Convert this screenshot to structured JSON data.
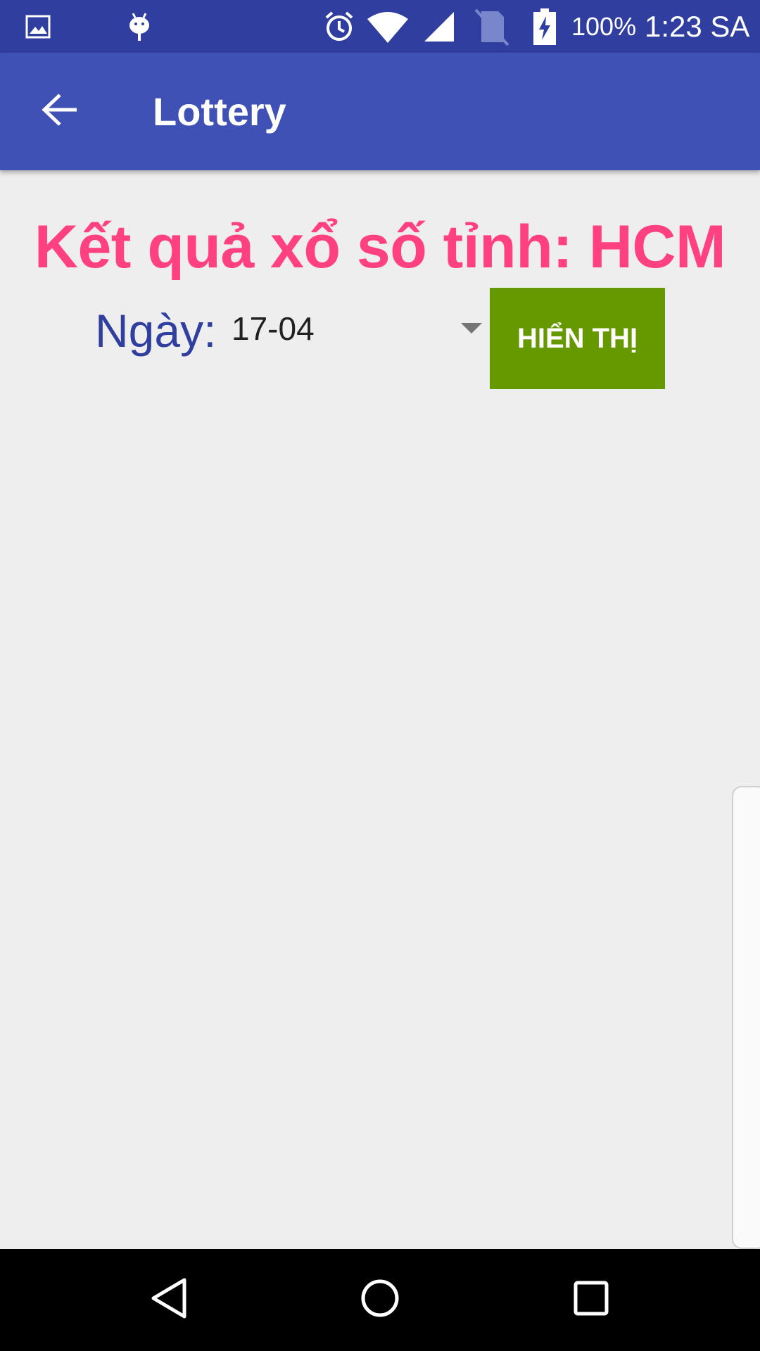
{
  "status_bar": {
    "battery_text": "100%",
    "time": "1:23 SA",
    "icons": [
      "image-icon",
      "android-debug-icon",
      "alarm-icon",
      "wifi-icon",
      "signal-icon",
      "no-sim-icon",
      "battery-charging-icon"
    ]
  },
  "app_bar": {
    "title": "Lottery",
    "back_icon": "arrow-back-icon"
  },
  "main": {
    "headline": "Kết quả xổ số tỉnh: HCM",
    "date_label": "Ngày:",
    "date_value": "17-04",
    "show_button_label": "HIỂN THỊ"
  },
  "nav_bar": {
    "icons": [
      "back-triangle-icon",
      "home-circle-icon",
      "recents-square-icon"
    ]
  },
  "colors": {
    "status_bar": "#303f9f",
    "app_bar": "#3f51b5",
    "headline": "#ff4081",
    "label": "#303f9f",
    "button": "#669900",
    "background": "#eeeeee"
  }
}
